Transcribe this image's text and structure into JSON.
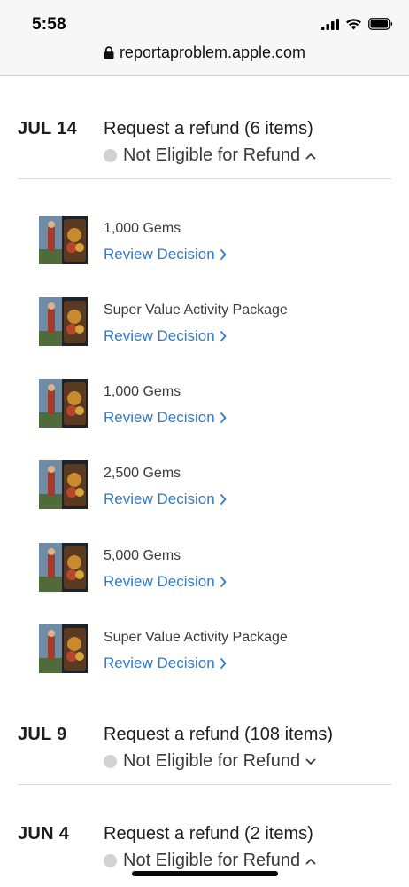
{
  "status_bar": {
    "time": "5:58"
  },
  "browser": {
    "url": "reportaproblem.apple.com"
  },
  "groups": [
    {
      "date": "JUL 14",
      "title": "Request a refund (6 items)",
      "status": "Not Eligible for Refund",
      "expanded": true,
      "items": [
        {
          "name": "1,000 Gems",
          "action": "Review Decision"
        },
        {
          "name": "Super Value Activity Package",
          "action": "Review Decision"
        },
        {
          "name": "1,000 Gems",
          "action": "Review Decision"
        },
        {
          "name": "2,500 Gems",
          "action": "Review Decision"
        },
        {
          "name": "5,000 Gems",
          "action": "Review Decision"
        },
        {
          "name": "Super Value Activity Package",
          "action": "Review Decision"
        }
      ]
    },
    {
      "date": "JUL 9",
      "title": "Request a refund (108 items)",
      "status": "Not Eligible for Refund",
      "expanded": false
    },
    {
      "date": "JUN 4",
      "title": "Request a refund (2 items)",
      "status": "Not Eligible for Refund",
      "expanded": true
    }
  ],
  "colors": {
    "link": "#2f7ac9",
    "status_dot": "#d1d1d6",
    "divider": "#d9d9d9"
  },
  "icons": {
    "lock": "lock-icon",
    "chevron_up": "chevron-up-icon",
    "chevron_down": "chevron-down-icon",
    "chevron_right": "chevron-right-icon"
  }
}
